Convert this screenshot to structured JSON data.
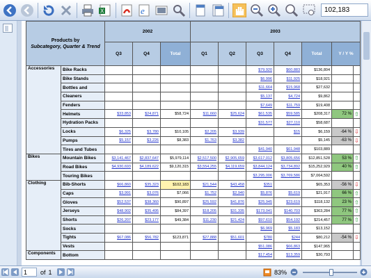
{
  "toolbar": {
    "icons": [
      "first-page",
      "previous-page",
      "refresh",
      "cancel",
      "print",
      "export-excel",
      "export-pdf",
      "export-html",
      "export-image",
      "find",
      "single-page",
      "continuous-pages",
      "hand-tool",
      "zoom-out",
      "zoom-in",
      "zoom-tool",
      "zoom-select"
    ],
    "zoom_value": "102,183"
  },
  "report": {
    "corner_title_line1": "Products by",
    "corner_title_line2": "Subcategory, Quarter & Trend",
    "years": [
      "2002",
      "2003"
    ],
    "col_headers": [
      "Q3",
      "Q4",
      "Total",
      "Q1",
      "Q2",
      "Q3",
      "Q4",
      "Total",
      "Y / Y %"
    ],
    "rows": [
      {
        "cat": "Accessories",
        "sub": "Bike Racks",
        "v": [
          "",
          "",
          "",
          "",
          "",
          "$79,920",
          "$60,883",
          "$136,804"
        ],
        "yy": "",
        "trend": ""
      },
      {
        "cat": "",
        "sub": "Bike Stands",
        "v": [
          "",
          "",
          "",
          "",
          "",
          "$6,996",
          "$11,925",
          "$18,921"
        ],
        "yy": "",
        "trend": ""
      },
      {
        "cat": "",
        "sub": "Bottles and",
        "v": [
          "",
          "",
          "",
          "",
          "",
          "$11,664",
          "$15,968",
          "$27,632"
        ],
        "yy": "",
        "trend": ""
      },
      {
        "cat": "",
        "sub": "Cleaners",
        "v": [
          "",
          "",
          "",
          "",
          "",
          "$5,137",
          "$4,724",
          "$9,862"
        ],
        "yy": "",
        "trend": ""
      },
      {
        "cat": "",
        "sub": "Fenders",
        "v": [
          "",
          "",
          "",
          "",
          "",
          "$7,649",
          "$11,759",
          "$19,408"
        ],
        "yy": "",
        "trend": ""
      },
      {
        "cat": "",
        "sub": "Helmets",
        "v": [
          "$33,853",
          "$24,871",
          "$58,724",
          "$11,660",
          "$25,624",
          "$61,535",
          "$59,585",
          "$208,317"
        ],
        "yy": "72 %",
        "trend": "up"
      },
      {
        "cat": "",
        "sub": "Hydration Packs",
        "v": [
          "",
          "",
          "",
          "",
          "",
          "$31,577",
          "$27,110",
          "$58,687"
        ],
        "yy": "",
        "trend": ""
      },
      {
        "cat": "",
        "sub": "Locks",
        "v": [
          "$6,325",
          "$3,780",
          "$10,105",
          "$2,205",
          "$3,939",
          "",
          "$15",
          "$6,159"
        ],
        "yy": "-64 %",
        "trend": "down"
      },
      {
        "cat": "",
        "sub": "Pumps",
        "v": [
          "$5,157",
          "$3,226",
          "$8,383",
          "$1,763",
          "$3,382",
          "",
          "",
          "$5,145"
        ],
        "yy": "-63 %",
        "trend": "down"
      },
      {
        "cat": "",
        "sub": "Tires and Tubes",
        "v": [
          "",
          "",
          "",
          "",
          "",
          "$41,940",
          "$61,948",
          "$103,889"
        ],
        "yy": "",
        "trend": ""
      },
      {
        "cat": "Bikes",
        "sub": "Mountain Bikes",
        "v": [
          "$3,141,467",
          "$2,837,647",
          "$5,979,114",
          "$2,517,500",
          "$2,905,659",
          "$3,617,012",
          "$3,805,656",
          "$12,851,528"
        ],
        "yy": "53 %",
        "trend": "up"
      },
      {
        "cat": "",
        "sub": "Road Bikes",
        "v": [
          "$4,930,693",
          "$4,189,622",
          "$9,120,315",
          "$3,554,255",
          "$4,119,659",
          "$3,844,124",
          "$3,734,892",
          "$15,252,929"
        ],
        "yy": "40 %",
        "trend": "up"
      },
      {
        "cat": "",
        "sub": "Touring Bikes",
        "v": [
          "",
          "",
          "",
          "",
          "",
          "$3,295,006",
          "$3,769,586",
          "$7,064,592"
        ],
        "yy": "",
        "trend": ""
      },
      {
        "cat": "Clothing",
        "sub": "Bib-Shorts",
        "v": [
          "$66,860",
          "$35,323",
          "$102,183",
          "$21,544",
          "$43,458",
          "$351",
          "",
          "$65,353"
        ],
        "yy": "-56 %",
        "trend": "down"
      },
      {
        "cat": "",
        "sub": "Caps",
        "v": [
          "$3,991",
          "$3,076",
          "$7,066",
          "$1,752",
          "$2,940",
          "$5,876",
          "$5,619",
          "$21,917"
        ],
        "yy": "66 %",
        "trend": "up"
      },
      {
        "cat": "",
        "sub": "Gloves",
        "v": [
          "$52,537",
          "$38,360",
          "$90,897",
          "$25,592",
          "$41,876",
          "$25,945",
          "$23,619",
          "$118,132"
        ],
        "yy": "23 %",
        "trend": "up"
      },
      {
        "cat": "",
        "sub": "Jerseys",
        "v": [
          "$48,902",
          "$35,495",
          "$84,397",
          "$18,205",
          "$31,335",
          "$173,041",
          "$140,703",
          "$363,284"
        ],
        "yy": "77 %",
        "trend": "up"
      },
      {
        "cat": "",
        "sub": "Shorts",
        "v": [
          "$26,207",
          "$23,177",
          "$49,384",
          "$11,230",
          "$21,424",
          "$97,610",
          "$54,192",
          "$214,457"
        ],
        "yy": "77 %",
        "trend": "up"
      },
      {
        "cat": "",
        "sub": "Socks",
        "v": [
          "",
          "",
          "",
          "",
          "",
          "$6,969",
          "$5,183",
          "$13,152"
        ],
        "yy": "",
        "trend": ""
      },
      {
        "cat": "",
        "sub": "Tights",
        "v": [
          "$67,086",
          "$56,782",
          "$123,871",
          "$27,888",
          "$51,601",
          "$780",
          "$244",
          "$80,212"
        ],
        "yy": "-54 %",
        "trend": "down"
      },
      {
        "cat": "",
        "sub": "Vests",
        "v": [
          "",
          "",
          "",
          "",
          "",
          "$51,086",
          "$66,863",
          "$147,965"
        ],
        "yy": "",
        "trend": ""
      },
      {
        "cat": "Components",
        "sub": "Bottom",
        "v": [
          "",
          "",
          "",
          "",
          "",
          "$17,454",
          "$13,359",
          "$30,793"
        ],
        "yy": "",
        "trend": ""
      }
    ],
    "highlight_cell": "$102,183",
    "colors": {
      "header_bg": "#b7cce4",
      "total_header_bg": "#8fb0d6",
      "positive_bg": "#8fc77f",
      "negative_bg": "#c9c9c9",
      "up_arrow": "#1b9a2f",
      "down_arrow": "#d7262d",
      "highlight": "#fff3b0"
    }
  },
  "statusbar": {
    "page": "1",
    "of_label": "of",
    "total_pages": "1",
    "zoom_percent": "83%"
  }
}
